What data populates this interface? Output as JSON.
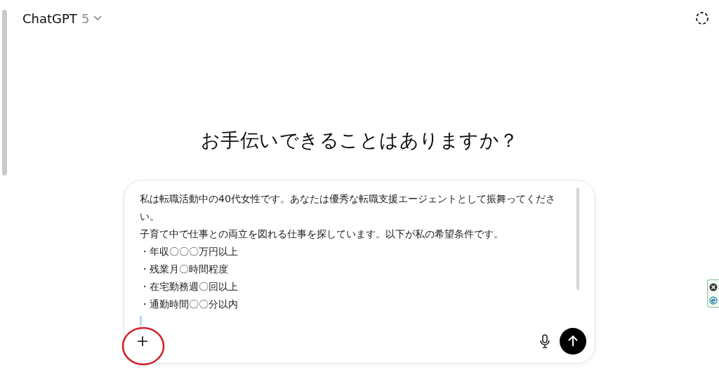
{
  "header": {
    "model_name": "ChatGPT",
    "model_version": "5"
  },
  "heading": "お手伝いできることはありますか？",
  "composer": {
    "lines": [
      "私は転職活動中の40代女性です。あなたは優秀な転職支援エージェントとして振舞ってください。",
      "子育て中で仕事との両立を図れる仕事を探しています。以下が私の希望条件です。",
      "・年収〇〇〇万円以上",
      "・残業月〇時間程度",
      "・在宅勤務週〇回以上",
      "・通勤時間〇〇分以内"
    ],
    "add_button": {
      "highlighted": true
    }
  }
}
